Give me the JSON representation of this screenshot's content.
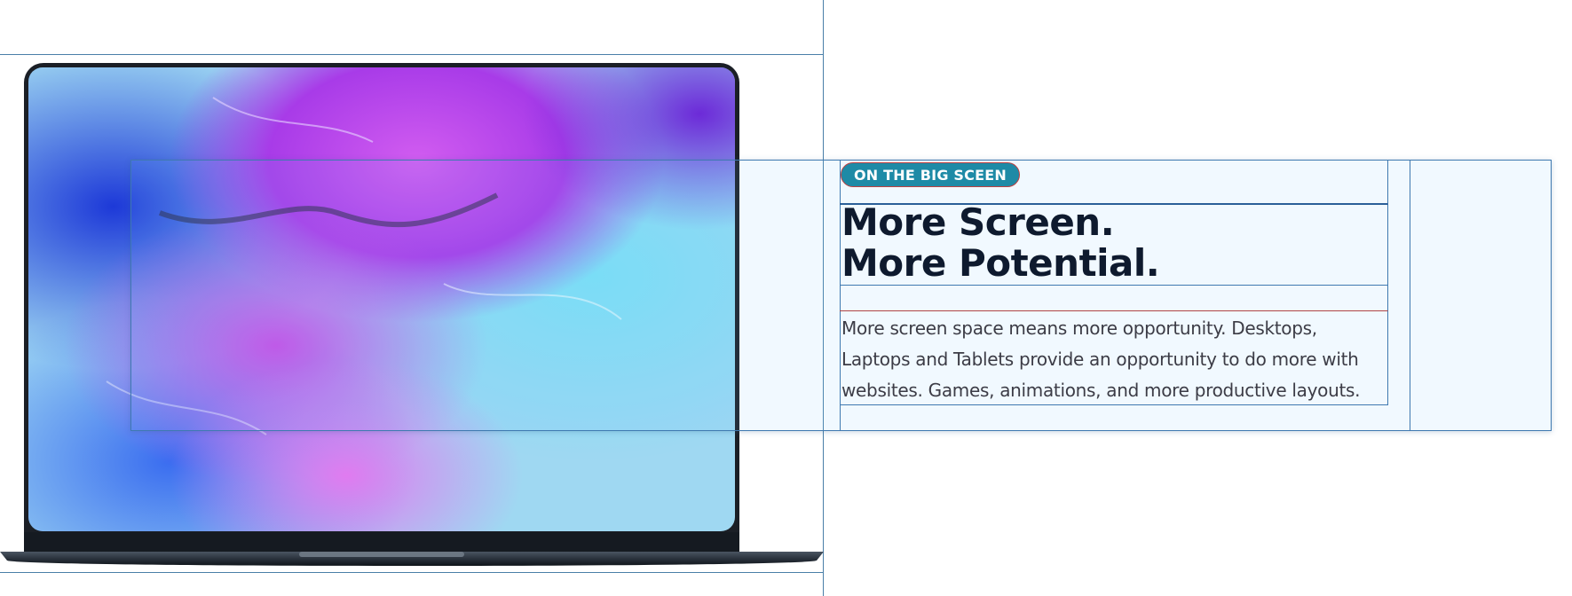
{
  "badge": {
    "label": "ON THE BIG SCEEN"
  },
  "heading": {
    "line1": "More Screen.",
    "line2": "More Potential."
  },
  "body": {
    "text": "More screen space means more opportunity. Desktops, Laptops and Tablets provide an opportunity to do more with websites. Games, animations, and more productive layouts."
  },
  "colors": {
    "badge_bg": "#1e8aa6",
    "heading": "#0e1a2e",
    "body": "#3c3c46",
    "guide": "#4a7fa8"
  },
  "icons": {
    "laptop": "laptop-image"
  }
}
